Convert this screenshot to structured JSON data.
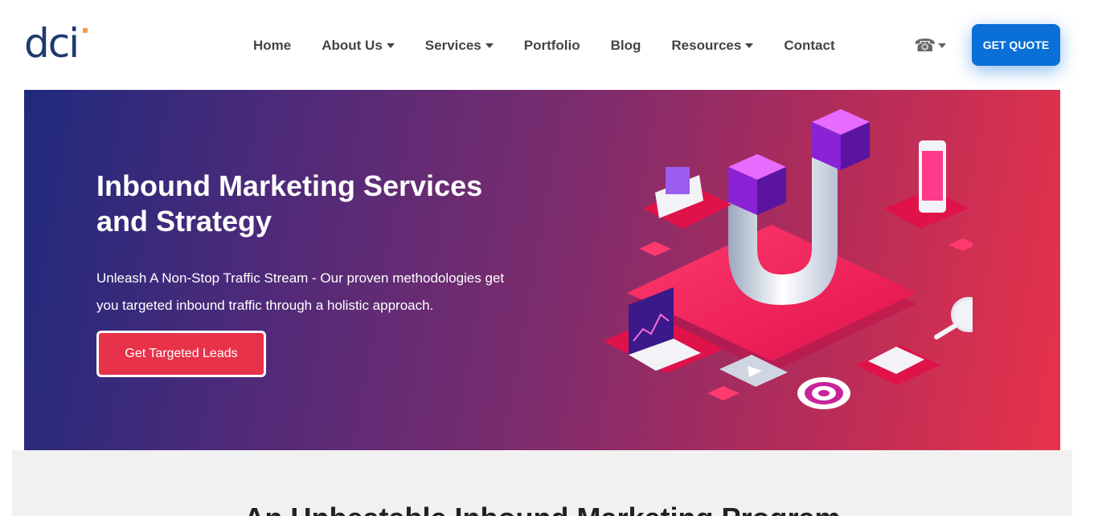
{
  "header": {
    "logo_text": "dci",
    "nav": [
      {
        "label": "Home",
        "dropdown": false
      },
      {
        "label": "About Us",
        "dropdown": true
      },
      {
        "label": "Services",
        "dropdown": true
      },
      {
        "label": "Portfolio",
        "dropdown": false
      },
      {
        "label": "Blog",
        "dropdown": false
      },
      {
        "label": "Resources",
        "dropdown": true
      },
      {
        "label": "Contact",
        "dropdown": false
      }
    ],
    "phone_icon": "phone-icon",
    "quote_button": "GET QUOTE"
  },
  "hero": {
    "title": "Inbound Marketing Services and Strategy",
    "subtitle": "Unleash A Non-Stop Traffic Stream - Our proven methodologies get you targeted inbound traffic through a holistic approach.",
    "cta": "Get Targeted Leads",
    "illustration": "magnet-marketing-illustration"
  },
  "section2": {
    "title": "An Unbeatable Inbound Marketing Program"
  },
  "colors": {
    "brand_blue": "#0a6fd6",
    "hero_gradient_start": "#1f2a7c",
    "hero_gradient_end": "#e8324a",
    "cta_red": "#e8324a",
    "logo_navy": "#1f3a6e",
    "logo_accent": "#f2994a"
  }
}
